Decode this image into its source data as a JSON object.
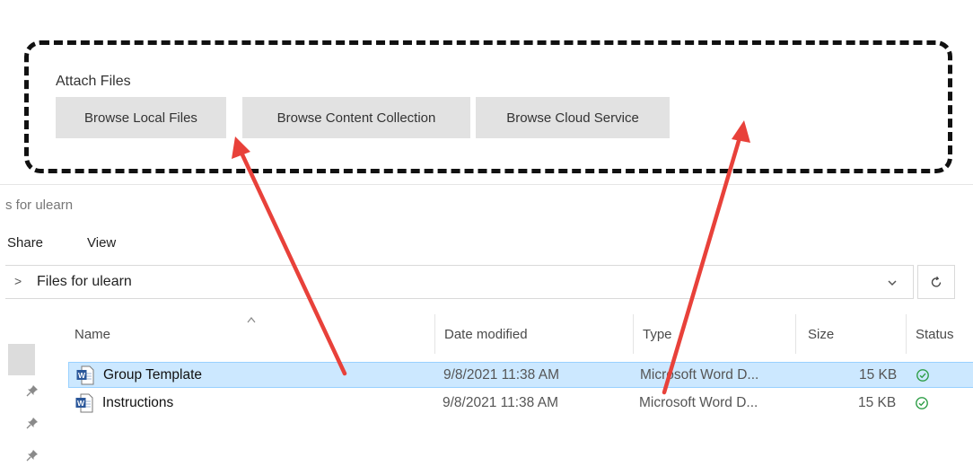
{
  "attach": {
    "label": "Attach Files",
    "buttons": {
      "local": "Browse Local Files",
      "content": "Browse Content Collection",
      "cloud": "Browse Cloud Service"
    }
  },
  "explorer": {
    "window_title": "s for ulearn",
    "ribbon": {
      "share": "Share",
      "view": "View"
    },
    "address": {
      "chevron": ">",
      "folder": "Files for ulearn"
    },
    "columns": {
      "name": "Name",
      "date": "Date modified",
      "type": "Type",
      "size": "Size",
      "status": "Status"
    },
    "files": [
      {
        "name": "Group Template",
        "date": "9/8/2021 11:38 AM",
        "type": "Microsoft Word D...",
        "size": "15 KB",
        "status": "synced",
        "selected": true
      },
      {
        "name": "Instructions",
        "date": "9/8/2021 11:38 AM",
        "type": "Microsoft Word D...",
        "size": "15 KB",
        "status": "synced",
        "selected": false
      }
    ]
  },
  "icons": {
    "word_doc": "word-document-icon",
    "status": "check-circle-icon",
    "pin": "pin-icon",
    "refresh": "refresh-icon",
    "dropdown": "chevron-down-icon",
    "sort": "sort-caret-icon"
  },
  "colors": {
    "selection_bg": "#cce8ff",
    "selection_border": "#99d1ff",
    "button_bg": "#e2e2e2",
    "annotation_arrow": "#e8413a",
    "status_green": "#2e9e47",
    "word_blue": "#2b579a"
  }
}
